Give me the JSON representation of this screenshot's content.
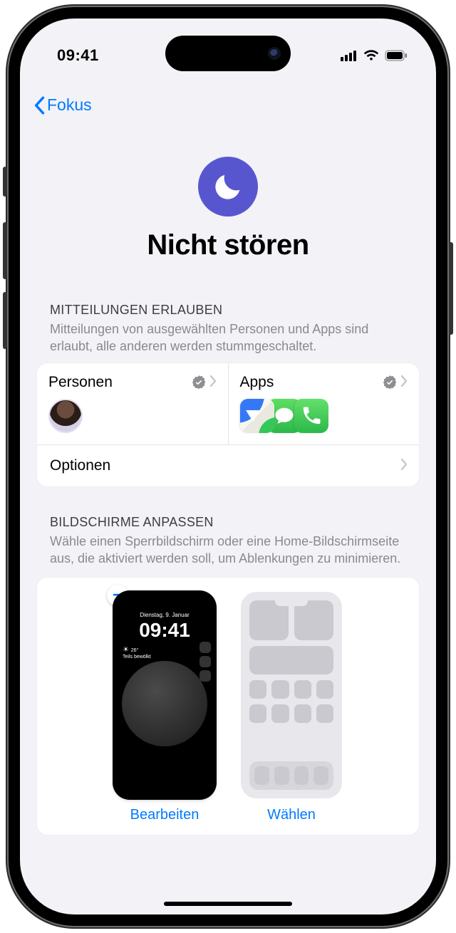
{
  "status": {
    "time": "09:41"
  },
  "nav": {
    "back": "Fokus"
  },
  "header": {
    "title": "Nicht stören"
  },
  "allow": {
    "heading": "MITTEILUNGEN ERLAUBEN",
    "description": "Mitteilungen von ausgewählten Personen und Apps sind erlaubt, alle anderen werden stummgeschaltet.",
    "people_label": "Personen",
    "apps_label": "Apps",
    "options_label": "Optionen"
  },
  "screens": {
    "heading": "BILDSCHIRME ANPASSEN",
    "description": "Wähle einen Sperrbildschirm oder eine Home-Bildschirmseite aus, die aktiviert werden soll, um Ablenkungen zu minimieren.",
    "lock_thumb": {
      "date": "Dienstag, 9. Januar",
      "time": "09:41",
      "widget_temp": "26°",
      "widget_desc": "Teils bewölkt"
    },
    "edit_label": "Bearbeiten",
    "choose_label": "Wählen"
  }
}
